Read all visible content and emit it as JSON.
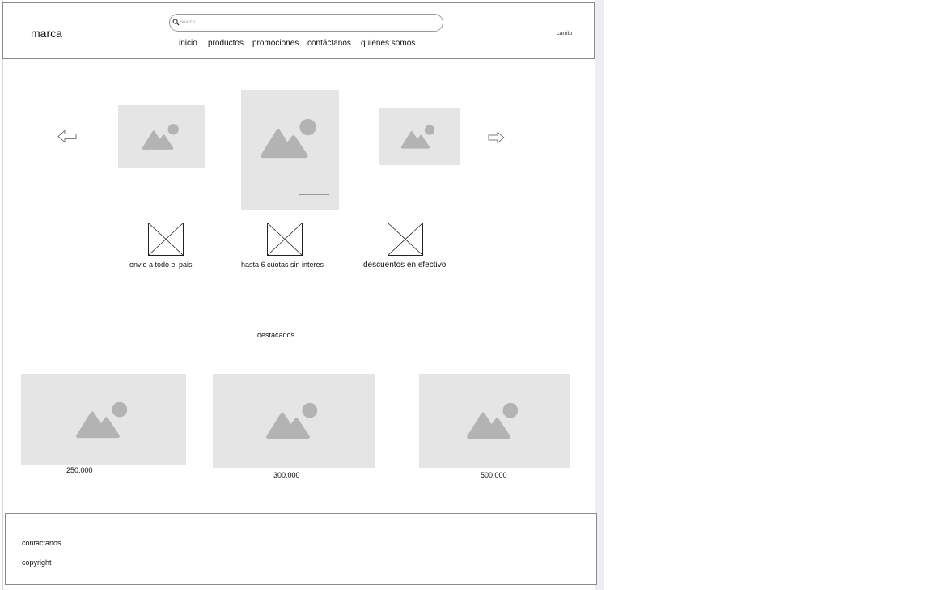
{
  "header": {
    "brand": "marca",
    "search": {
      "placeholder": "Search",
      "value": ""
    },
    "nav": [
      {
        "label": "inicio"
      },
      {
        "label": "productos"
      },
      {
        "label": "promociones"
      },
      {
        "label": "contáctanos"
      },
      {
        "label": "quienes somos"
      }
    ],
    "cart_label": "carrito"
  },
  "carousel": {
    "prev_icon": "arrow-left-icon",
    "next_icon": "arrow-right-icon",
    "placeholder_icon": "image-placeholder-icon"
  },
  "features": [
    {
      "label": "envio a todo el pais",
      "icon": "image-missing-icon"
    },
    {
      "label": "hasta 6 cuotas sin interes",
      "icon": "image-missing-icon"
    },
    {
      "label": "descuentos en efectivo",
      "icon": "image-missing-icon"
    }
  ],
  "featured": {
    "title": "destacados",
    "products": [
      {
        "price": "250.000"
      },
      {
        "price": "300.000"
      },
      {
        "price": "500.000"
      }
    ]
  },
  "footer": {
    "links": [
      {
        "label": "contactanos"
      },
      {
        "label": "copyright"
      }
    ]
  },
  "colors": {
    "placeholder_bg": "#e5e5e5",
    "placeholder_glyph": "#b3b3b3",
    "border": "#8a8a8a"
  }
}
